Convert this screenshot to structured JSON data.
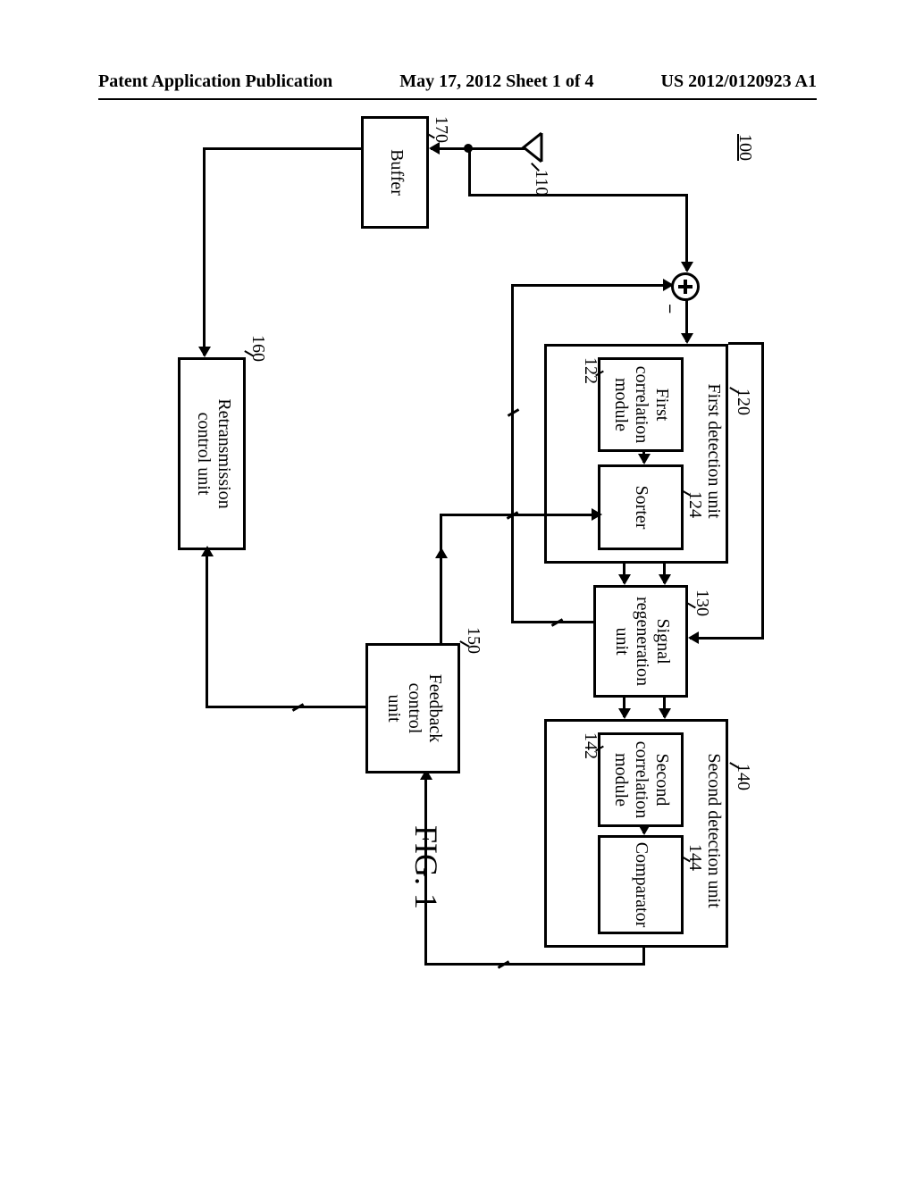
{
  "header": {
    "left": "Patent Application Publication",
    "center": "May 17, 2012  Sheet 1 of 4",
    "right": "US 2012/0120923 A1"
  },
  "refs": {
    "system": "100",
    "antenna": "110",
    "buffer_ref": "170",
    "first_det_ref": "120",
    "first_corr_ref": "122",
    "sorter_ref": "124",
    "signal_regen_ref": "130",
    "second_det_ref": "140",
    "second_corr_ref": "142",
    "comparator_ref": "144",
    "feedback_ref": "150",
    "retrans_ref": "160"
  },
  "blocks": {
    "buffer": "Buffer",
    "first_det": "First detection unit",
    "first_corr": "First\ncorrelation\nmodule",
    "sorter": "Sorter",
    "signal_regen": "Signal\nregeneration\nunit",
    "second_det": "Second detection unit",
    "second_corr": "Second\ncorrelation\nmodule",
    "comparator": "Comparator",
    "feedback": "Feedback\ncontrol\nunit",
    "retrans": "Retransmission\ncontrol unit"
  },
  "figure": "FIG. 1"
}
